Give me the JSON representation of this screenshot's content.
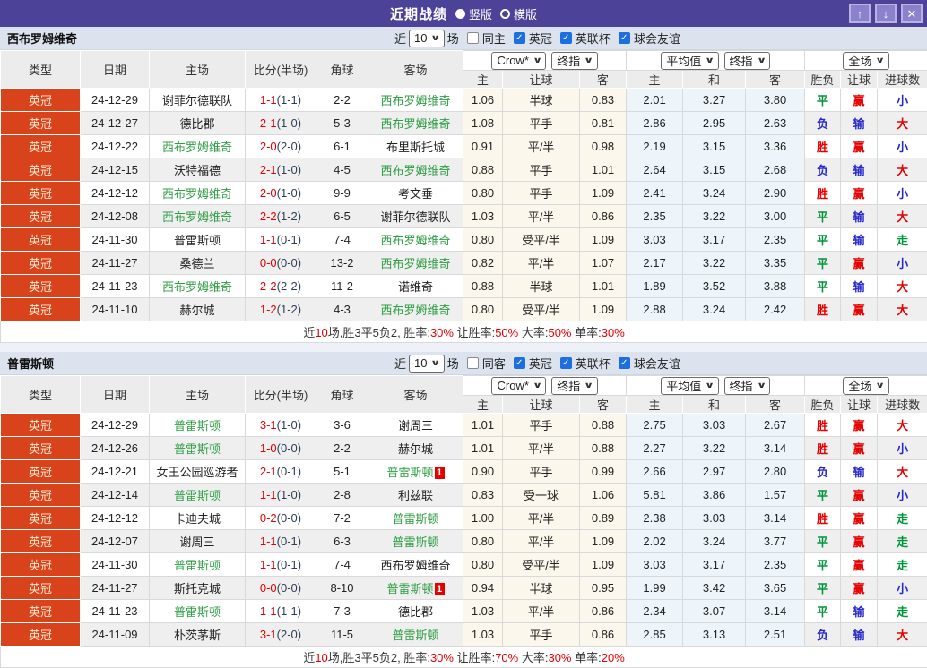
{
  "title_bar": {
    "title": "近期战绩",
    "radio_vertical": "竖版",
    "radio_horizontal": "横版"
  },
  "icons": {
    "up": "↑",
    "down": "↓",
    "close": "✕",
    "check": "✓",
    "chevron": "∨"
  },
  "colors": {
    "titlebar": "#4c4399",
    "league_badge_bg": "#d8431b",
    "self_team_green": "#2f9e44",
    "win_red": "#e60000",
    "draw_green": "#00963c",
    "lose_blue": "#2626cc",
    "checkbox_blue": "#1b6fe0",
    "crow_col_bg": "#fcf7ec",
    "avg_col_bg": "#edf5fa"
  },
  "labels": {
    "near": "近",
    "games": "场"
  },
  "columns": {
    "type": "类型",
    "date": "日期",
    "home": "主场",
    "score": "比分(半场)",
    "corner": "角球",
    "away": "客场",
    "selects": {
      "crow": "Crow*",
      "final": "终指",
      "avg": "平均值",
      "full": "全场"
    },
    "odds_home": "主",
    "odds_handicap": "让球",
    "odds_away": "客",
    "avg_home": "主",
    "avg_draw": "和",
    "avg_away": "客",
    "res_wdl": "胜负",
    "res_handicap": "让球",
    "res_goals": "进球数"
  },
  "tables": [
    {
      "team": "西布罗姆维奇",
      "count": "10",
      "same_label": "同主",
      "same_checked": false,
      "leagues": [
        {
          "label": "英冠",
          "checked": true
        },
        {
          "label": "英联杯",
          "checked": true
        },
        {
          "label": "球会友谊",
          "checked": true
        }
      ],
      "rows": [
        {
          "league": "英冠",
          "date": "24-12-29",
          "home": "谢菲尔德联队",
          "home_self": false,
          "home_red": 0,
          "score": "1-1",
          "half": "(1-1)",
          "corner": "2-2",
          "away": "西布罗姆维奇",
          "away_self": true,
          "away_red": 0,
          "o1": "1.06",
          "o2": "半球",
          "o3": "0.83",
          "a1": "2.01",
          "a2": "3.27",
          "a3": "3.80",
          "r1": "平",
          "c1": "green",
          "r2": "赢",
          "c2": "red",
          "r3": "小",
          "c3": "blue"
        },
        {
          "league": "英冠",
          "date": "24-12-27",
          "home": "德比郡",
          "home_self": false,
          "home_red": 0,
          "score": "2-1",
          "half": "(1-0)",
          "corner": "5-3",
          "away": "西布罗姆维奇",
          "away_self": true,
          "away_red": 0,
          "o1": "1.08",
          "o2": "平手",
          "o3": "0.81",
          "a1": "2.86",
          "a2": "2.95",
          "a3": "2.63",
          "r1": "负",
          "c1": "blue",
          "r2": "输",
          "c2": "blue",
          "r3": "大",
          "c3": "red"
        },
        {
          "league": "英冠",
          "date": "24-12-22",
          "home": "西布罗姆维奇",
          "home_self": true,
          "home_red": 0,
          "score": "2-0",
          "half": "(2-0)",
          "corner": "6-1",
          "away": "布里斯托城",
          "away_self": false,
          "away_red": 0,
          "o1": "0.91",
          "o2": "平/半",
          "o3": "0.98",
          "a1": "2.19",
          "a2": "3.15",
          "a3": "3.36",
          "r1": "胜",
          "c1": "red",
          "r2": "赢",
          "c2": "red",
          "r3": "小",
          "c3": "blue"
        },
        {
          "league": "英冠",
          "date": "24-12-15",
          "home": "沃特福德",
          "home_self": false,
          "home_red": 0,
          "score": "2-1",
          "half": "(1-0)",
          "corner": "4-5",
          "away": "西布罗姆维奇",
          "away_self": true,
          "away_red": 0,
          "o1": "0.88",
          "o2": "平手",
          "o3": "1.01",
          "a1": "2.64",
          "a2": "3.15",
          "a3": "2.68",
          "r1": "负",
          "c1": "blue",
          "r2": "输",
          "c2": "blue",
          "r3": "大",
          "c3": "red"
        },
        {
          "league": "英冠",
          "date": "24-12-12",
          "home": "西布罗姆维奇",
          "home_self": true,
          "home_red": 0,
          "score": "2-0",
          "half": "(1-0)",
          "corner": "9-9",
          "away": "考文垂",
          "away_self": false,
          "away_red": 0,
          "o1": "0.80",
          "o2": "平手",
          "o3": "1.09",
          "a1": "2.41",
          "a2": "3.24",
          "a3": "2.90",
          "r1": "胜",
          "c1": "red",
          "r2": "赢",
          "c2": "red",
          "r3": "小",
          "c3": "blue"
        },
        {
          "league": "英冠",
          "date": "24-12-08",
          "home": "西布罗姆维奇",
          "home_self": true,
          "home_red": 0,
          "score": "2-2",
          "half": "(1-2)",
          "corner": "6-5",
          "away": "谢菲尔德联队",
          "away_self": false,
          "away_red": 0,
          "o1": "1.03",
          "o2": "平/半",
          "o3": "0.86",
          "a1": "2.35",
          "a2": "3.22",
          "a3": "3.00",
          "r1": "平",
          "c1": "green",
          "r2": "输",
          "c2": "blue",
          "r3": "大",
          "c3": "red"
        },
        {
          "league": "英冠",
          "date": "24-11-30",
          "home": "普雷斯顿",
          "home_self": false,
          "home_red": 0,
          "score": "1-1",
          "half": "(0-1)",
          "corner": "7-4",
          "away": "西布罗姆维奇",
          "away_self": true,
          "away_red": 0,
          "o1": "0.80",
          "o2": "受平/半",
          "o3": "1.09",
          "a1": "3.03",
          "a2": "3.17",
          "a3": "2.35",
          "r1": "平",
          "c1": "green",
          "r2": "输",
          "c2": "blue",
          "r3": "走",
          "c3": "green"
        },
        {
          "league": "英冠",
          "date": "24-11-27",
          "home": "桑德兰",
          "home_self": false,
          "home_red": 0,
          "score": "0-0",
          "half": "(0-0)",
          "corner": "13-2",
          "away": "西布罗姆维奇",
          "away_self": true,
          "away_red": 0,
          "o1": "0.82",
          "o2": "平/半",
          "o3": "1.07",
          "a1": "2.17",
          "a2": "3.22",
          "a3": "3.35",
          "r1": "平",
          "c1": "green",
          "r2": "赢",
          "c2": "red",
          "r3": "小",
          "c3": "blue"
        },
        {
          "league": "英冠",
          "date": "24-11-23",
          "home": "西布罗姆维奇",
          "home_self": true,
          "home_red": 0,
          "score": "2-2",
          "half": "(2-2)",
          "corner": "11-2",
          "away": "诺维奇",
          "away_self": false,
          "away_red": 0,
          "o1": "0.88",
          "o2": "半球",
          "o3": "1.01",
          "a1": "1.89",
          "a2": "3.52",
          "a3": "3.88",
          "r1": "平",
          "c1": "green",
          "r2": "输",
          "c2": "blue",
          "r3": "大",
          "c3": "red"
        },
        {
          "league": "英冠",
          "date": "24-11-10",
          "home": "赫尔城",
          "home_self": false,
          "home_red": 0,
          "score": "1-2",
          "half": "(1-2)",
          "corner": "4-3",
          "away": "西布罗姆维奇",
          "away_self": true,
          "away_red": 0,
          "o1": "0.80",
          "o2": "受平/半",
          "o3": "1.09",
          "a1": "2.88",
          "a2": "3.24",
          "a3": "2.42",
          "r1": "胜",
          "c1": "red",
          "r2": "赢",
          "c2": "red",
          "r3": "大",
          "c3": "red"
        }
      ],
      "summary": [
        {
          "t": "近"
        },
        {
          "t": "10",
          "red": true
        },
        {
          "t": "场,胜3平5负2, 胜率:"
        },
        {
          "t": "30%",
          "red": true
        },
        {
          "t": " 让胜率:"
        },
        {
          "t": "50%",
          "red": true
        },
        {
          "t": " 大率:"
        },
        {
          "t": "50%",
          "red": true
        },
        {
          "t": " 单率:"
        },
        {
          "t": "30%",
          "red": true
        }
      ]
    },
    {
      "team": "普雷斯顿",
      "count": "10",
      "same_label": "同客",
      "same_checked": false,
      "leagues": [
        {
          "label": "英冠",
          "checked": true
        },
        {
          "label": "英联杯",
          "checked": true
        },
        {
          "label": "球会友谊",
          "checked": true
        }
      ],
      "rows": [
        {
          "league": "英冠",
          "date": "24-12-29",
          "home": "普雷斯顿",
          "home_self": true,
          "home_red": 0,
          "score": "3-1",
          "half": "(1-0)",
          "corner": "3-6",
          "away": "谢周三",
          "away_self": false,
          "away_red": 0,
          "o1": "1.01",
          "o2": "平手",
          "o3": "0.88",
          "a1": "2.75",
          "a2": "3.03",
          "a3": "2.67",
          "r1": "胜",
          "c1": "red",
          "r2": "赢",
          "c2": "red",
          "r3": "大",
          "c3": "red"
        },
        {
          "league": "英冠",
          "date": "24-12-26",
          "home": "普雷斯顿",
          "home_self": true,
          "home_red": 0,
          "score": "1-0",
          "half": "(0-0)",
          "corner": "2-2",
          "away": "赫尔城",
          "away_self": false,
          "away_red": 0,
          "o1": "1.01",
          "o2": "平/半",
          "o3": "0.88",
          "a1": "2.27",
          "a2": "3.22",
          "a3": "3.14",
          "r1": "胜",
          "c1": "red",
          "r2": "赢",
          "c2": "red",
          "r3": "小",
          "c3": "blue"
        },
        {
          "league": "英冠",
          "date": "24-12-21",
          "home": "女王公园巡游者",
          "home_self": false,
          "home_red": 0,
          "score": "2-1",
          "half": "(0-1)",
          "corner": "5-1",
          "away": "普雷斯顿",
          "away_self": true,
          "away_red": 1,
          "o1": "0.90",
          "o2": "平手",
          "o3": "0.99",
          "a1": "2.66",
          "a2": "2.97",
          "a3": "2.80",
          "r1": "负",
          "c1": "blue",
          "r2": "输",
          "c2": "blue",
          "r3": "大",
          "c3": "red"
        },
        {
          "league": "英冠",
          "date": "24-12-14",
          "home": "普雷斯顿",
          "home_self": true,
          "home_red": 0,
          "score": "1-1",
          "half": "(1-0)",
          "corner": "2-8",
          "away": "利兹联",
          "away_self": false,
          "away_red": 0,
          "o1": "0.83",
          "o2": "受一球",
          "o3": "1.06",
          "a1": "5.81",
          "a2": "3.86",
          "a3": "1.57",
          "r1": "平",
          "c1": "green",
          "r2": "赢",
          "c2": "red",
          "r3": "小",
          "c3": "blue"
        },
        {
          "league": "英冠",
          "date": "24-12-12",
          "home": "卡迪夫城",
          "home_self": false,
          "home_red": 0,
          "score": "0-2",
          "half": "(0-0)",
          "corner": "7-2",
          "away": "普雷斯顿",
          "away_self": true,
          "away_red": 0,
          "o1": "1.00",
          "o2": "平/半",
          "o3": "0.89",
          "a1": "2.38",
          "a2": "3.03",
          "a3": "3.14",
          "r1": "胜",
          "c1": "red",
          "r2": "赢",
          "c2": "red",
          "r3": "走",
          "c3": "green"
        },
        {
          "league": "英冠",
          "date": "24-12-07",
          "home": "谢周三",
          "home_self": false,
          "home_red": 0,
          "score": "1-1",
          "half": "(0-1)",
          "corner": "6-3",
          "away": "普雷斯顿",
          "away_self": true,
          "away_red": 0,
          "o1": "0.80",
          "o2": "平/半",
          "o3": "1.09",
          "a1": "2.02",
          "a2": "3.24",
          "a3": "3.77",
          "r1": "平",
          "c1": "green",
          "r2": "赢",
          "c2": "red",
          "r3": "走",
          "c3": "green"
        },
        {
          "league": "英冠",
          "date": "24-11-30",
          "home": "普雷斯顿",
          "home_self": true,
          "home_red": 0,
          "score": "1-1",
          "half": "(0-1)",
          "corner": "7-4",
          "away": "西布罗姆维奇",
          "away_self": false,
          "away_red": 0,
          "o1": "0.80",
          "o2": "受平/半",
          "o3": "1.09",
          "a1": "3.03",
          "a2": "3.17",
          "a3": "2.35",
          "r1": "平",
          "c1": "green",
          "r2": "赢",
          "c2": "red",
          "r3": "走",
          "c3": "green"
        },
        {
          "league": "英冠",
          "date": "24-11-27",
          "home": "斯托克城",
          "home_self": false,
          "home_red": 0,
          "score": "0-0",
          "half": "(0-0)",
          "corner": "8-10",
          "away": "普雷斯顿",
          "away_self": true,
          "away_red": 1,
          "o1": "0.94",
          "o2": "半球",
          "o3": "0.95",
          "a1": "1.99",
          "a2": "3.42",
          "a3": "3.65",
          "r1": "平",
          "c1": "green",
          "r2": "赢",
          "c2": "red",
          "r3": "小",
          "c3": "blue"
        },
        {
          "league": "英冠",
          "date": "24-11-23",
          "home": "普雷斯顿",
          "home_self": true,
          "home_red": 0,
          "score": "1-1",
          "half": "(1-1)",
          "corner": "7-3",
          "away": "德比郡",
          "away_self": false,
          "away_red": 0,
          "o1": "1.03",
          "o2": "平/半",
          "o3": "0.86",
          "a1": "2.34",
          "a2": "3.07",
          "a3": "3.14",
          "r1": "平",
          "c1": "green",
          "r2": "输",
          "c2": "blue",
          "r3": "走",
          "c3": "green"
        },
        {
          "league": "英冠",
          "date": "24-11-09",
          "home": "朴茨茅斯",
          "home_self": false,
          "home_red": 0,
          "score": "3-1",
          "half": "(2-0)",
          "corner": "11-5",
          "away": "普雷斯顿",
          "away_self": true,
          "away_red": 0,
          "o1": "1.03",
          "o2": "平手",
          "o3": "0.86",
          "a1": "2.85",
          "a2": "3.13",
          "a3": "2.51",
          "r1": "负",
          "c1": "blue",
          "r2": "输",
          "c2": "blue",
          "r3": "大",
          "c3": "red"
        }
      ],
      "summary": [
        {
          "t": "近"
        },
        {
          "t": "10",
          "red": true
        },
        {
          "t": "场,胜3平5负2, 胜率:"
        },
        {
          "t": "30%",
          "red": true
        },
        {
          "t": " 让胜率:"
        },
        {
          "t": "70%",
          "red": true
        },
        {
          "t": " 大率:"
        },
        {
          "t": "30%",
          "red": true
        },
        {
          "t": " 单率:"
        },
        {
          "t": "20%",
          "red": true
        }
      ]
    }
  ]
}
